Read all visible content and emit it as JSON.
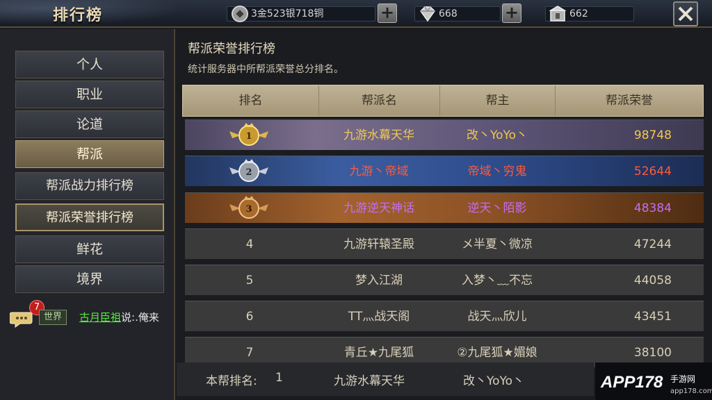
{
  "header": {
    "title": "排行榜",
    "currency": "3金523银718铜",
    "diamonds": "668",
    "vouchers": "662"
  },
  "sidebar": {
    "items": [
      {
        "label": "个人"
      },
      {
        "label": "职业"
      },
      {
        "label": "论道"
      },
      {
        "label": "帮派"
      },
      {
        "label": "帮派战力排行榜"
      },
      {
        "label": "帮派荣誉排行榜"
      },
      {
        "label": "鲜花"
      },
      {
        "label": "境界"
      }
    ]
  },
  "chat": {
    "badge": "7",
    "channel": "世界",
    "sender": "古月臣祖",
    "message": "说:.俺来"
  },
  "main": {
    "title": "帮派荣誉排行榜",
    "desc": "统计服务器中所帮派荣誉总分排名。",
    "columns": [
      "排名",
      "帮派名",
      "帮主",
      "帮派荣誉"
    ],
    "rows": [
      {
        "rank": "1",
        "guild": "九游水幕天华",
        "leader": "改丶YoYo丶",
        "honor": "98748"
      },
      {
        "rank": "2",
        "guild": "九游丶帝域",
        "leader": "帝域丶穷鬼",
        "honor": "52644"
      },
      {
        "rank": "3",
        "guild": "九游逆天神话",
        "leader": "逆天丶陌影",
        "honor": "48384"
      },
      {
        "rank": "4",
        "guild": "九游轩辕圣殿",
        "leader": "メ半夏丶微凉",
        "honor": "47244"
      },
      {
        "rank": "5",
        "guild": "梦入江湖",
        "leader": "入梦丶﹏不忘",
        "honor": "44058"
      },
      {
        "rank": "6",
        "guild": "TT灬战天阁",
        "leader": "战天灬欣儿",
        "honor": "43451"
      },
      {
        "rank": "7",
        "guild": "青丘★九尾狐",
        "leader": "②九尾狐★媚娘",
        "honor": "38100"
      }
    ],
    "colors": {
      "row1": "#f2c94c",
      "row2": "#ff5a3a",
      "row3": "#c46ef0",
      "normal": "#e6e0d0"
    }
  },
  "footer": {
    "label": "本帮排名:",
    "rank": "1",
    "guild": "九游水幕天华",
    "leader": "改丶YoYo丶"
  },
  "watermark": {
    "brand": "APP178",
    "site": "手游网",
    "domain": "app178.com"
  }
}
